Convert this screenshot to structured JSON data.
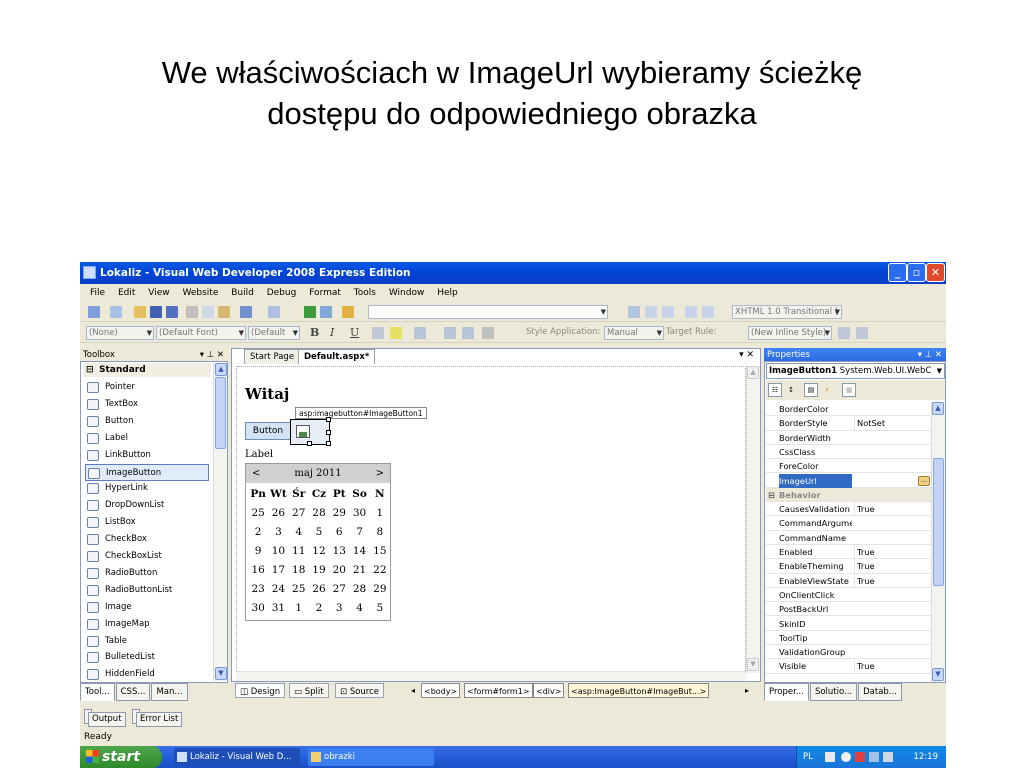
{
  "slide": {
    "title_line1": "We właściwościach w ImageUrl wybieramy ścieżkę",
    "title_line2": "dostępu do odpowiedniego obrazka"
  },
  "window": {
    "title": "Lokaliz - Visual Web Developer 2008 Express Edition"
  },
  "menu": [
    "File",
    "Edit",
    "View",
    "Website",
    "Build",
    "Debug",
    "Format",
    "Tools",
    "Window",
    "Help"
  ],
  "toolbar": {
    "doctype": "XHTML 1.0 Transitional (",
    "block_format": "(None)",
    "font": "(Default Font)",
    "size": "(Default",
    "bold": "B",
    "italic": "I",
    "underline": "U",
    "style_app_label": "Style Application:",
    "style_app_value": "Manual",
    "target_rule_label": "Target Rule:",
    "target_rule_value": "(New Inline Style)"
  },
  "toolbox": {
    "title": "Toolbox",
    "group": "Standard",
    "items": [
      {
        "label": "Pointer",
        "icon": "pointer-icon"
      },
      {
        "label": "TextBox",
        "icon": "textbox-icon"
      },
      {
        "label": "Button",
        "icon": "button-icon"
      },
      {
        "label": "Label",
        "icon": "label-icon"
      },
      {
        "label": "LinkButton",
        "icon": "linkbutton-icon"
      },
      {
        "label": "ImageButton",
        "icon": "imagebutton-icon",
        "selected": true
      },
      {
        "label": "HyperLink",
        "icon": "hyperlink-icon"
      },
      {
        "label": "DropDownList",
        "icon": "dropdownlist-icon"
      },
      {
        "label": "ListBox",
        "icon": "listbox-icon"
      },
      {
        "label": "CheckBox",
        "icon": "checkbox-icon"
      },
      {
        "label": "CheckBoxList",
        "icon": "checkboxlist-icon"
      },
      {
        "label": "RadioButton",
        "icon": "radiobutton-icon"
      },
      {
        "label": "RadioButtonList",
        "icon": "radiobuttonlist-icon"
      },
      {
        "label": "Image",
        "icon": "image-icon"
      },
      {
        "label": "ImageMap",
        "icon": "imagemap-icon"
      },
      {
        "label": "Table",
        "icon": "table-icon"
      },
      {
        "label": "BulletedList",
        "icon": "bulletedlist-icon"
      },
      {
        "label": "HiddenField",
        "icon": "hiddenfield-icon"
      }
    ],
    "tabs": [
      "Tool...",
      "CSS...",
      "Man..."
    ]
  },
  "editor": {
    "tabs": [
      "Start Page",
      "Default.aspx*"
    ],
    "close": "▾ ✕",
    "heading": "Witaj",
    "tag": "asp:imagebutton#ImageButton1",
    "button_label": "Button",
    "label_text": "Label",
    "calendar": {
      "prev": "<",
      "next": ">",
      "month": "maj 2011",
      "days": [
        "Pn",
        "Wt",
        "Śr",
        "Cz",
        "Pt",
        "So",
        "N"
      ],
      "weeks": [
        [
          "25",
          "26",
          "27",
          "28",
          "29",
          "30",
          "1"
        ],
        [
          "2",
          "3",
          "4",
          "5",
          "6",
          "7",
          "8"
        ],
        [
          "9",
          "10",
          "11",
          "12",
          "13",
          "14",
          "15"
        ],
        [
          "16",
          "17",
          "18",
          "19",
          "20",
          "21",
          "22"
        ],
        [
          "23",
          "24",
          "25",
          "26",
          "27",
          "28",
          "29"
        ],
        [
          "30",
          "31",
          "1",
          "2",
          "3",
          "4",
          "5"
        ]
      ]
    },
    "views": {
      "design": "Design",
      "split": "Split",
      "source": "Source"
    },
    "breadcrumb": [
      "<body>",
      "<form#form1>",
      "<div>",
      "<asp:ImageButton#ImageBut...>"
    ]
  },
  "properties": {
    "title": "Properties",
    "object_name": "ImageButton1",
    "object_type": "System.Web.UI.WebC",
    "rows": [
      {
        "name": "BorderColor",
        "value": ""
      },
      {
        "name": "BorderStyle",
        "value": "NotSet"
      },
      {
        "name": "BorderWidth",
        "value": ""
      },
      {
        "name": "CssClass",
        "value": ""
      },
      {
        "name": "ForeColor",
        "value": ""
      },
      {
        "name": "ImageUrl",
        "value": "",
        "highlight": true
      },
      {
        "name": "Behavior",
        "value": "",
        "category": true
      },
      {
        "name": "CausesValidation",
        "value": "True"
      },
      {
        "name": "CommandArgume",
        "value": ""
      },
      {
        "name": "CommandName",
        "value": ""
      },
      {
        "name": "Enabled",
        "value": "True"
      },
      {
        "name": "EnableTheming",
        "value": "True"
      },
      {
        "name": "EnableViewState",
        "value": "True"
      },
      {
        "name": "OnClientClick",
        "value": ""
      },
      {
        "name": "PostBackUrl",
        "value": ""
      },
      {
        "name": "SkinID",
        "value": ""
      },
      {
        "name": "ToolTip",
        "value": ""
      },
      {
        "name": "ValidationGroup",
        "value": ""
      },
      {
        "name": "Visible",
        "value": "True"
      }
    ],
    "tabs": [
      "Proper...",
      "Solutio...",
      "Datab..."
    ]
  },
  "bottom": {
    "output": "Output",
    "errors": "Error List",
    "status": "Ready"
  },
  "taskbar": {
    "start": "start",
    "task1": "Lokaliz - Visual Web D...",
    "task2": "obrazki",
    "lang": "PL",
    "clock": "12:19"
  }
}
